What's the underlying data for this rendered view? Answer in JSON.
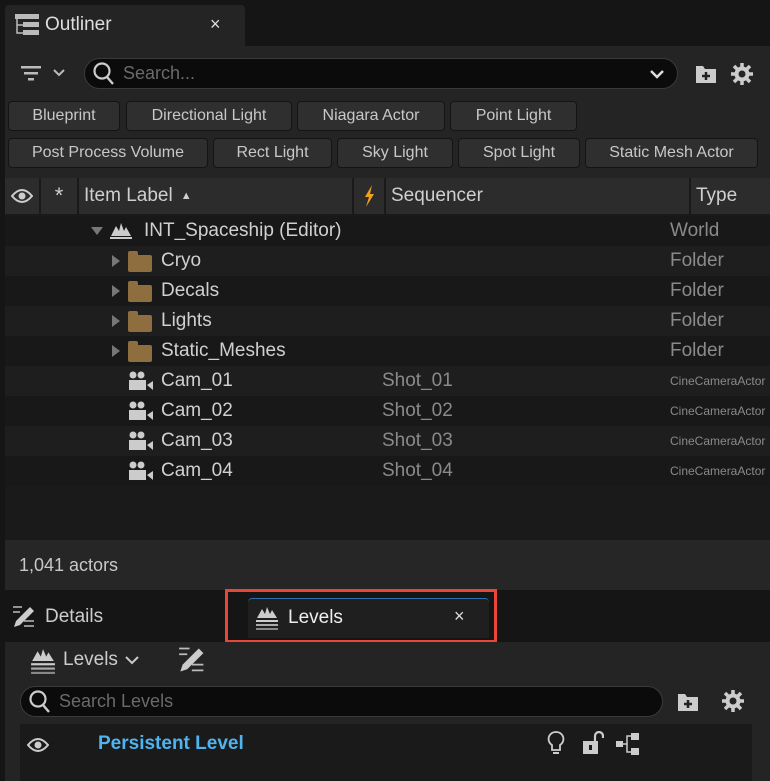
{
  "outliner": {
    "tab_title": "Outliner",
    "search_placeholder": "Search...",
    "filters_row1": [
      "Blueprint",
      "Directional Light",
      "Niagara Actor",
      "Point Light"
    ],
    "filters_row2": [
      "Post Process Volume",
      "Rect Light",
      "Sky Light",
      "Spot Light",
      "Static Mesh Actor"
    ],
    "columns": {
      "label": "Item Label",
      "sequencer": "Sequencer",
      "type": "Type"
    },
    "rows": [
      {
        "label": "INT_Spaceship (Editor)",
        "sequencer": "",
        "type": "World",
        "icon": "level-icon",
        "expanded": true
      },
      {
        "label": "Cryo",
        "sequencer": "",
        "type": "Folder",
        "icon": "folder-icon"
      },
      {
        "label": "Decals",
        "sequencer": "",
        "type": "Folder",
        "icon": "folder-icon"
      },
      {
        "label": "Lights",
        "sequencer": "",
        "type": "Folder",
        "icon": "folder-icon"
      },
      {
        "label": "Static_Meshes",
        "sequencer": "",
        "type": "Folder",
        "icon": "folder-icon"
      },
      {
        "label": "Cam_01",
        "sequencer": "Shot_01",
        "type": "CineCameraActor",
        "icon": "camera-icon"
      },
      {
        "label": "Cam_02",
        "sequencer": "Shot_02",
        "type": "CineCameraActor",
        "icon": "camera-icon"
      },
      {
        "label": "Cam_03",
        "sequencer": "Shot_03",
        "type": "CineCameraActor",
        "icon": "camera-icon"
      },
      {
        "label": "Cam_04",
        "sequencer": "Shot_04",
        "type": "CineCameraActor",
        "icon": "camera-icon"
      }
    ],
    "status": "1,041 actors"
  },
  "lower": {
    "details_tab": "Details",
    "levels_tab": "Levels",
    "levels_dropdown": "Levels",
    "search_placeholder": "Search Levels",
    "persistent_level": "Persistent Level"
  },
  "colors": {
    "accent_blue": "#4fb3f0",
    "highlight_red": "#e8463a",
    "folder": "#8e6e3f",
    "lightning": "#f0a020"
  }
}
